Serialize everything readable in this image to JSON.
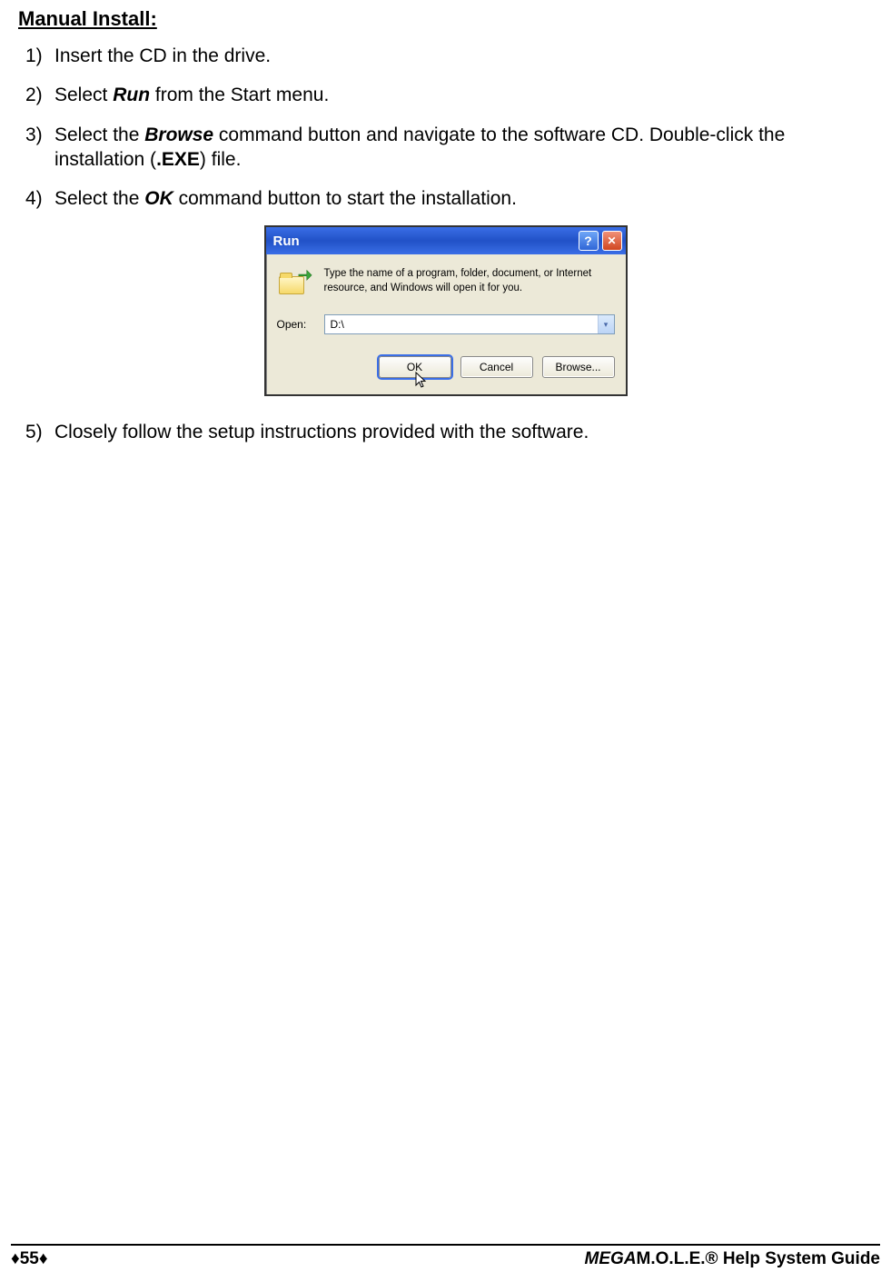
{
  "heading": "Manual Install:",
  "steps": {
    "s1_num": "1)",
    "s1_text": "Insert the CD in the drive.",
    "s2_num": "2)",
    "s2_pre": "Select ",
    "s2_bi": "Run",
    "s2_post": " from the Start menu.",
    "s3_num": "3)",
    "s3_pre": "Select the ",
    "s3_bi": "Browse",
    "s3_mid": " command button and navigate to the software CD. Double-click the installation (",
    "s3_b": ".EXE",
    "s3_post": ") file.",
    "s4_num": "4)",
    "s4_pre": "Select the ",
    "s4_bi": "OK",
    "s4_post": " command button to start the installation.",
    "s5_num": "5)",
    "s5_text": "Closely follow the setup instructions provided with the software."
  },
  "dialog": {
    "title": "Run",
    "description": "Type the name of a program, folder, document, or Internet resource, and Windows will open it for you.",
    "open_label": "Open:",
    "open_value": "D:\\",
    "ok": "OK",
    "cancel": "Cancel",
    "browse": "Browse..."
  },
  "footer": {
    "left": "♦55♦",
    "right_i": "MEGA",
    "right_rest": "M.O.L.E.® Help System Guide"
  }
}
